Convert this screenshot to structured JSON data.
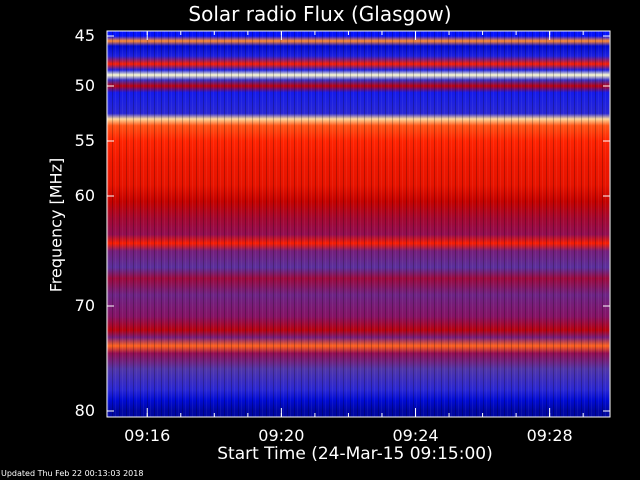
{
  "chart_data": {
    "type": "heatmap",
    "title": "Solar radio Flux (Glasgow)",
    "ylabel": "Frequency [MHz]",
    "xlabel": "Start Time (24-Mar-15 09:15:00)",
    "ylim": [
      80,
      45
    ],
    "xlim_minutes": [
      0,
      15
    ],
    "yticks": [
      {
        "label": "45",
        "value": 45
      },
      {
        "label": "50",
        "value": 50
      },
      {
        "label": "55",
        "value": 55
      },
      {
        "label": "60",
        "value": 60
      },
      {
        "label": "70",
        "value": 70
      },
      {
        "label": "80",
        "value": 80
      }
    ],
    "xticks": [
      {
        "label": "09:16",
        "value": 1.2
      },
      {
        "label": "09:20",
        "value": 5.2
      },
      {
        "label": "09:24",
        "value": 9.2
      },
      {
        "label": "09:28",
        "value": 13.2
      }
    ],
    "intensity_profile": [
      {
        "freq": 45.0,
        "level": 0.15
      },
      {
        "freq": 45.5,
        "level": 0.85
      },
      {
        "freq": 46.0,
        "level": 0.1
      },
      {
        "freq": 47.0,
        "level": 0.2
      },
      {
        "freq": 47.8,
        "level": 0.7
      },
      {
        "freq": 48.4,
        "level": 0.2
      },
      {
        "freq": 48.9,
        "level": 1.0
      },
      {
        "freq": 49.4,
        "level": 0.25
      },
      {
        "freq": 50.0,
        "level": 0.55
      },
      {
        "freq": 50.6,
        "level": 0.18
      },
      {
        "freq": 51.5,
        "level": 0.2
      },
      {
        "freq": 52.5,
        "level": 0.22
      },
      {
        "freq": 53.0,
        "level": 0.95
      },
      {
        "freq": 53.6,
        "level": 0.78
      },
      {
        "freq": 55.0,
        "level": 0.72
      },
      {
        "freq": 57.0,
        "level": 0.68
      },
      {
        "freq": 59.0,
        "level": 0.66
      },
      {
        "freq": 60.5,
        "level": 0.58
      },
      {
        "freq": 62.0,
        "level": 0.5
      },
      {
        "freq": 63.5,
        "level": 0.45
      },
      {
        "freq": 64.3,
        "level": 0.7
      },
      {
        "freq": 65.0,
        "level": 0.38
      },
      {
        "freq": 66.5,
        "level": 0.32
      },
      {
        "freq": 67.5,
        "level": 0.48
      },
      {
        "freq": 69.0,
        "level": 0.36
      },
      {
        "freq": 71.0,
        "level": 0.42
      },
      {
        "freq": 72.3,
        "level": 0.55
      },
      {
        "freq": 73.0,
        "level": 0.38
      },
      {
        "freq": 73.8,
        "level": 0.8
      },
      {
        "freq": 74.5,
        "level": 0.45
      },
      {
        "freq": 76.0,
        "level": 0.3
      },
      {
        "freq": 78.0,
        "level": 0.22
      },
      {
        "freq": 79.0,
        "level": 0.1
      },
      {
        "freq": 80.0,
        "level": 0.05
      }
    ],
    "colormap": [
      "#000070",
      "#0010ff",
      "#4b3ab0",
      "#8a1060",
      "#c00000",
      "#ff2000",
      "#ff9030",
      "#ffffd0"
    ]
  },
  "footer": {
    "updated": "Updated Thu Feb 22 00:13:03 2018"
  }
}
